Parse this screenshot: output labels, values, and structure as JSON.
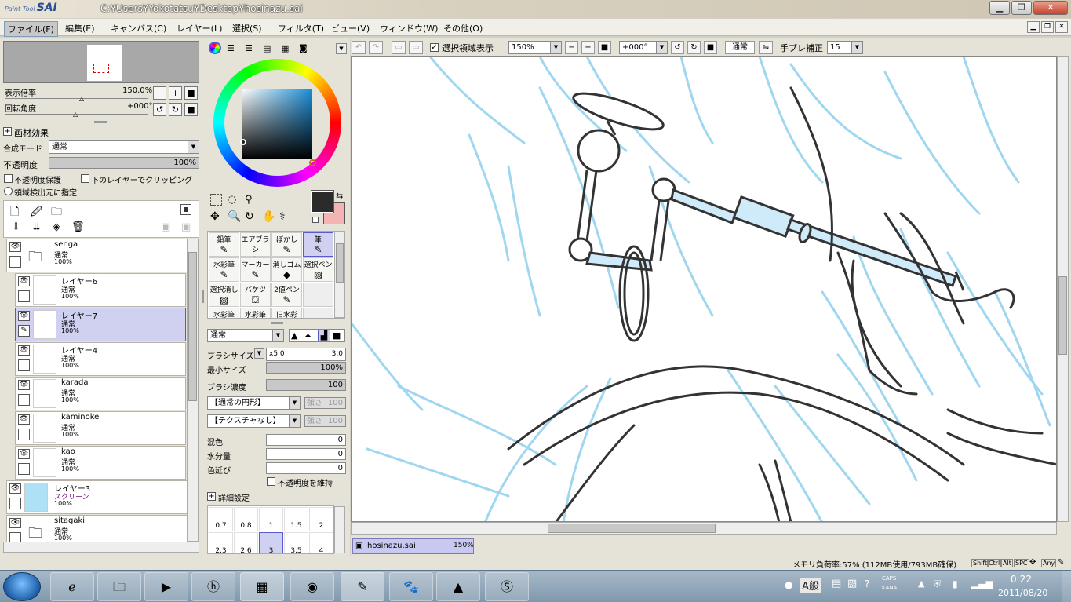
{
  "window": {
    "logo_small": "Paint Tool",
    "logo": "SAI",
    "path": "C:¥Users¥Yokotatsu¥Desktop¥hosinazu.sai"
  },
  "menu": [
    {
      "label": "ファイル(F)"
    },
    {
      "label": "編集(E)"
    },
    {
      "label": "キャンバス(C)"
    },
    {
      "label": "レイヤー(L)"
    },
    {
      "label": "選択(S)"
    },
    {
      "label": "フィルタ(T)"
    },
    {
      "label": "ビュー(V)"
    },
    {
      "label": "ウィンドウ(W)"
    },
    {
      "label": "その他(O)"
    }
  ],
  "navigator": {
    "zoom_label": "表示倍率",
    "zoom_value": "150.0%",
    "rotate_label": "回転角度",
    "rotate_value": "+000°"
  },
  "layer_props": {
    "effects_label": "画材効果",
    "blend_label": "合成モード",
    "blend_value": "通常",
    "opacity_label": "不透明度",
    "opacity_value": "100%",
    "protect_label": "不透明度保護",
    "clip_label": "下のレイヤーでクリッピング",
    "region_label": "領域検出元に指定"
  },
  "layers": [
    {
      "name": "senga",
      "mode": "通常",
      "opacity": "100%"
    },
    {
      "name": "レイヤー6",
      "mode": "通常",
      "opacity": "100%"
    },
    {
      "name": "レイヤー7",
      "mode": "通常",
      "opacity": "100%"
    },
    {
      "name": "レイヤー4",
      "mode": "通常",
      "opacity": "100%"
    },
    {
      "name": "karada",
      "mode": "通常",
      "opacity": "100%"
    },
    {
      "name": "kaminoke",
      "mode": "通常",
      "opacity": "100%"
    },
    {
      "name": "kao",
      "mode": "通常",
      "opacity": "100%"
    },
    {
      "name": "レイヤー3",
      "mode": "スクリーン",
      "opacity": "100%"
    },
    {
      "name": "sitagaki",
      "mode": "通常",
      "opacity": "100%"
    }
  ],
  "tools": [
    {
      "label": "鉛筆",
      "icon": "✎"
    },
    {
      "label": "エアブラシ",
      "icon": "✈"
    },
    {
      "label": "ぼかし",
      "icon": "✎"
    },
    {
      "label": "筆",
      "icon": "✎"
    },
    {
      "label": "水彩筆",
      "icon": "✎"
    },
    {
      "label": "マーカー",
      "icon": "✎"
    },
    {
      "label": "消しゴム",
      "icon": "◆"
    },
    {
      "label": "選択ペン",
      "icon": "▨"
    },
    {
      "label": "選択消し",
      "icon": "▨"
    },
    {
      "label": "バケツ",
      "icon": "⛋"
    },
    {
      "label": "2値ペン",
      "icon": "✎"
    },
    {
      "label": "",
      "icon": ""
    },
    {
      "label": "水彩筆",
      "icon": ""
    },
    {
      "label": "水彩筆",
      "icon": ""
    },
    {
      "label": "旧水彩",
      "icon": ""
    },
    {
      "label": "",
      "icon": ""
    }
  ],
  "brush": {
    "mode": "通常",
    "size_label": "ブラシサイズ",
    "size_mult": "x5.0",
    "size_value": "3.0",
    "min_size_label": "最小サイズ",
    "min_size_value": "100%",
    "density_label": "ブラシ濃度",
    "density_value": "100",
    "shape": "【通常の円形】",
    "shape_strength_label": "強さ",
    "shape_strength": "100",
    "texture": "【テクスチャなし】",
    "texture_strength_label": "強さ",
    "texture_strength": "100",
    "mix_label": "混色",
    "mix_value": "0",
    "water_label": "水分量",
    "water_value": "0",
    "stretch_label": "色延び",
    "stretch_value": "0",
    "keep_opacity_label": "不透明度を維持",
    "detail_label": "詳細設定"
  },
  "brush_sizes": [
    "0.7",
    "0.8",
    "1",
    "1.5",
    "2",
    "2.3",
    "2.6",
    "3",
    "3.5",
    "4"
  ],
  "canvas_toolbar": {
    "selection_label": "選択領域表示",
    "zoom": "150%",
    "rotation": "+000°",
    "blend": "通常",
    "stabilizer_label": "手ブレ補正",
    "stabilizer_value": "15"
  },
  "doc_tab": {
    "name": "hosinazu.sai",
    "zoom": "150%"
  },
  "status": {
    "memory": "メモリ負荷率:57% (112MB使用/793MB確保)",
    "keys": [
      "Shift",
      "Ctrl",
      "Alt",
      "SPC",
      "Any"
    ]
  },
  "taskbar": {
    "ime": "A般",
    "caps": "CAPS",
    "kana": "KANA",
    "time": "0:22",
    "date": "2011/08/20"
  },
  "colors": {
    "main_color": "#2b2b2b",
    "sub_color": "#f4b4b4",
    "sketch_blue": "#9fd6f0"
  }
}
